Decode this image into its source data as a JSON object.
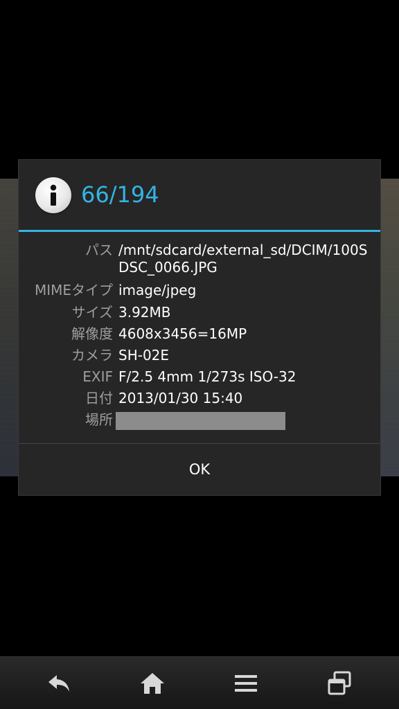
{
  "dialog": {
    "title": "66/194",
    "icon": "info-icon",
    "accent_color": "#33b5e5",
    "rows": [
      {
        "label": "パス",
        "value": "/mnt/sdcard/external_sd/DCIM/100SDSC_0066.JPG"
      },
      {
        "label": "MIMEタイプ",
        "value": "image/jpeg"
      },
      {
        "label": "サイズ",
        "value": "3.92MB"
      },
      {
        "label": "解像度",
        "value": "4608x3456=16MP"
      },
      {
        "label": "カメラ",
        "value": "SH-02E"
      },
      {
        "label": "EXIF",
        "value": "F/2.5 4mm 1/273s ISO-32"
      },
      {
        "label": "日付",
        "value": "2013/01/30 15:40"
      },
      {
        "label": "場所",
        "value": ""
      }
    ],
    "ok_label": "OK"
  },
  "navbar": {
    "icons": [
      "back-icon",
      "home-icon",
      "menu-icon",
      "recent-apps-icon"
    ]
  }
}
